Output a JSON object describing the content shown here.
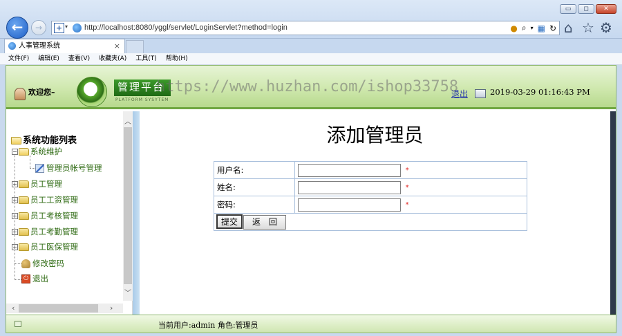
{
  "browser": {
    "url": "http://localhost:8080/yggl/servlet/LoginServlet?method=login",
    "tab_title": "人事管理系统",
    "tab_close": "×",
    "menu": [
      "文件(F)",
      "编辑(E)",
      "查看(V)",
      "收藏夹(A)",
      "工具(T)",
      "帮助(H)"
    ],
    "window_buttons": [
      "▭",
      "◻",
      "✕"
    ]
  },
  "header": {
    "welcome": "欢迎您–",
    "logo_text": "管理平台",
    "logo_subtitle": "PLATFORM SYSYTEM",
    "watermark": "https://www.huzhan.com/ishop33758",
    "logout_link": "退出",
    "datetime": "2019-03-29 01:16:43 PM"
  },
  "sidebar": {
    "root": "系统功能列表",
    "items": [
      {
        "label": "系统维护",
        "expander": "−"
      },
      {
        "label": "管理员帐号管理"
      },
      {
        "label": "员工管理",
        "expander": "+"
      },
      {
        "label": "员工工资管理",
        "expander": "+"
      },
      {
        "label": "员工考核管理",
        "expander": "+"
      },
      {
        "label": "员工考勤管理",
        "expander": "+"
      },
      {
        "label": "员工医保管理",
        "expander": "+"
      },
      {
        "label": "修改密码"
      },
      {
        "label": "退出"
      }
    ]
  },
  "form": {
    "title": "添加管理员",
    "fields": [
      {
        "label": "用户名:",
        "value": "",
        "required": "*"
      },
      {
        "label": "姓名:",
        "value": "",
        "required": "*"
      },
      {
        "label": "密码:",
        "value": "",
        "required": "*"
      }
    ],
    "submit": "提交",
    "back": "返　回"
  },
  "status": {
    "text": "当前用户:admin  角色:管理员"
  }
}
